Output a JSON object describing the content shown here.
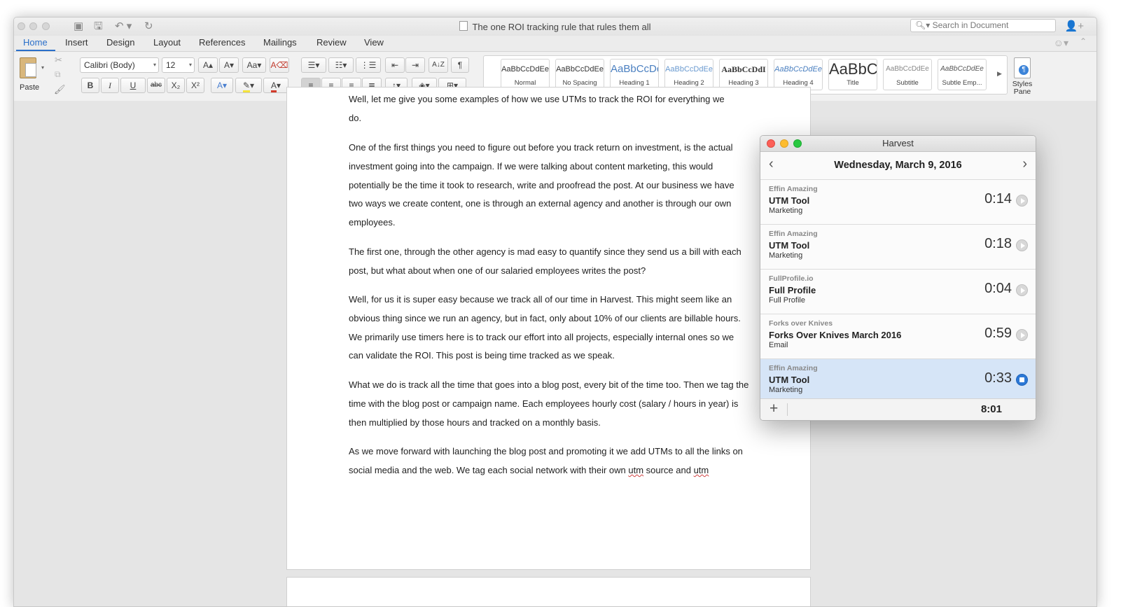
{
  "window": {
    "title": "The one ROI tracking rule that rules them all"
  },
  "search": {
    "placeholder": "Search in Document"
  },
  "tabs": [
    "Home",
    "Insert",
    "Design",
    "Layout",
    "References",
    "Mailings",
    "Review",
    "View"
  ],
  "ribbon": {
    "paste_label": "Paste",
    "font_name": "Calibri (Body)",
    "font_size": "12",
    "bold": "B",
    "italic": "I",
    "underline": "U",
    "strike": "abc",
    "subscript": "X₂",
    "superscript": "X²",
    "styles": [
      {
        "sample": "AaBbCcDdEe",
        "name": "Normal"
      },
      {
        "sample": "AaBbCcDdEe",
        "name": "No Spacing"
      },
      {
        "sample": "AaBbCcDc",
        "name": "Heading 1"
      },
      {
        "sample": "AaBbCcDdEe",
        "name": "Heading 2"
      },
      {
        "sample": "AaBbCcDdI",
        "name": "Heading 3"
      },
      {
        "sample": "AaBbCcDdEe",
        "name": "Heading 4"
      },
      {
        "sample": "AaBbC",
        "name": "Title"
      },
      {
        "sample": "AaBbCcDdEe",
        "name": "Subtitle"
      },
      {
        "sample": "AaBbCcDdEe",
        "name": "Subtle Emp..."
      }
    ],
    "styles_pane_label_1": "Styles",
    "styles_pane_label_2": "Pane"
  },
  "document": {
    "cut_line_1": "Well, let me give you some examples of how we use UTMs to track the ROI for everything we",
    "cut_line_2": "do.",
    "p1": "One of the first things you need to figure out before you track return on investment, is the actual investment going into the campaign. If we were talking about content marketing, this would potentially be the time it took to research, write and proofread the post. At our business we have two ways we create content, one is through an external agency and another is through our own employees.",
    "p2": "The first one, through the other agency is mad easy to quantify since they send us a bill with each post, but what about when one of our salaried employees writes the post?",
    "p3": "Well, for us it is super easy because we track all of our time in Harvest. This might seem like an obvious thing since we run an agency, but in fact, only about 10% of our clients are billable hours. We primarily use timers here is to track our effort into all projects, especially internal ones so we can validate the ROI. This post is being time tracked as we speak.",
    "p4": "What we do is track all the time that goes into a blog post, every bit of the time too. Then we tag the time with the blog post or campaign name. Each employees hourly cost (salary / hours in year) is then multiplied by those hours and tracked on a monthly basis.",
    "p5_a": "As we move forward with launching the blog post and promoting it we add UTMs to all the links on social media and the web. We tag each social network with their own ",
    "p5_spell_1": "utm",
    "p5_b": " source and ",
    "p5_spell_2": "utm"
  },
  "harvest": {
    "title": "Harvest",
    "date": "Wednesday, March 9, 2016",
    "entries": [
      {
        "client": "Effin Amazing",
        "project": "UTM Tool",
        "task": "Marketing",
        "time": "0:14",
        "running": false
      },
      {
        "client": "Effin Amazing",
        "project": "UTM Tool",
        "task": "Marketing",
        "time": "0:18",
        "running": false
      },
      {
        "client": "FullProfile.io",
        "project": "Full Profile",
        "task": "Full Profile",
        "time": "0:04",
        "running": false
      },
      {
        "client": "Forks over Knives",
        "project": "Forks Over Knives March 2016",
        "task": "Email",
        "time": "0:59",
        "running": false
      },
      {
        "client": "Effin Amazing",
        "project": "UTM Tool",
        "task": "Marketing",
        "time": "0:33",
        "running": true
      }
    ],
    "total": "8:01"
  }
}
